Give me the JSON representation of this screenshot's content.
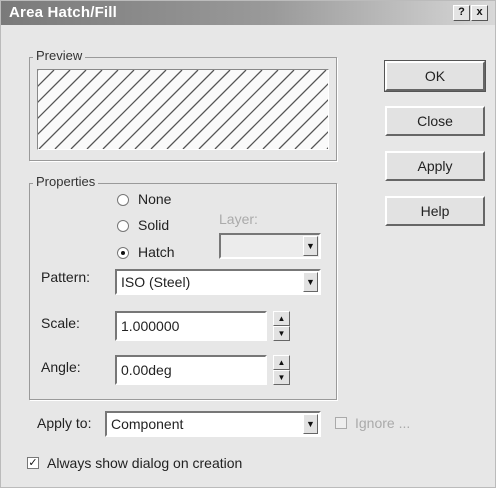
{
  "window": {
    "title": "Area Hatch/Fill",
    "help_glyph": "?",
    "close_glyph": "x"
  },
  "preview": {
    "label": "Preview"
  },
  "buttons": {
    "ok": "OK",
    "close": "Close",
    "apply": "Apply",
    "help": "Help"
  },
  "properties": {
    "label": "Properties",
    "radios": [
      {
        "label": "None",
        "selected": false
      },
      {
        "label": "Solid",
        "selected": false
      },
      {
        "label": "Hatch",
        "selected": true
      }
    ],
    "layer_label": "Layer:",
    "layer_value": "",
    "pattern_label": "Pattern:",
    "pattern_value": "ISO (Steel)",
    "scale_label": "Scale:",
    "scale_value": "1.000000",
    "angle_label": "Angle:",
    "angle_value": "0.00deg"
  },
  "apply_to": {
    "label": "Apply to:",
    "value": "Component"
  },
  "ignore_check": {
    "label": "Ignore ...",
    "checked": false,
    "enabled": false
  },
  "always_show": {
    "label": "Always show dialog on creation",
    "checked": true
  },
  "icons": {
    "dropdown": "down-triangle",
    "spin_up": "up-triangle",
    "spin_down": "down-triangle"
  }
}
